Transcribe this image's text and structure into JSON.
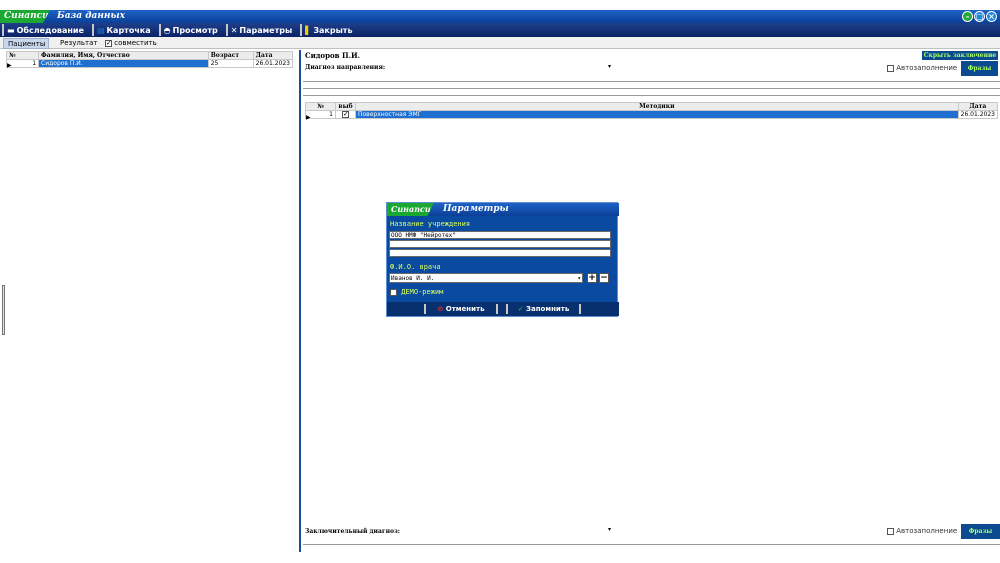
{
  "window": {
    "logo": "Синапсис",
    "title": "База данных",
    "buttons": [
      "–",
      "□",
      "×"
    ]
  },
  "toolbar": [
    {
      "label": "Обследование",
      "icon": "exam-icon"
    },
    {
      "label": "Карточка",
      "icon": "card-icon"
    },
    {
      "label": "Просмотр",
      "icon": "view-icon"
    },
    {
      "label": "Параметры",
      "icon": "settings-icon"
    },
    {
      "label": "Закрыть",
      "icon": "close-door-icon"
    }
  ],
  "tabs": {
    "patients": "Пациенты",
    "result": "Результат",
    "combine": "совместить",
    "combine_checked": true
  },
  "patients_table": {
    "headers": [
      "№",
      "Фамилия, Имя, Отчество",
      "Возраст",
      "Дата"
    ],
    "rows": [
      {
        "num": "1",
        "name": "Сидоров П.И.",
        "age": "25",
        "date": "26.01.2023"
      }
    ]
  },
  "right": {
    "patient_name": "Сидоров П.И.",
    "hide_conclusion": "Скрыть заключение",
    "referral_label": "Диагноз направления:",
    "autofill": "Автозаполнение",
    "phrases": "Фразы",
    "methods_table": {
      "headers": [
        "№",
        "выб",
        "Методики",
        "Дата"
      ],
      "rows": [
        {
          "num": "1",
          "selected": true,
          "method": "Поверхностная ЭМГ",
          "date": "26.01.2023"
        }
      ]
    },
    "final_label": "Заключительный диагноз:",
    "autofill2": "Автозаполнение",
    "phrases2": "Фразы"
  },
  "dialog": {
    "logo": "Синапсис",
    "title": "Параметры",
    "institution_label": "Название учреждения",
    "institution_value": "ООО НМФ \"Нейротех\"",
    "doctor_label": "Ф.И.О. врача",
    "doctor_value": "Иванов И. И.",
    "demo_label": "ДЕМО-режим",
    "cancel": "Отменить",
    "save": "Запомнить"
  }
}
